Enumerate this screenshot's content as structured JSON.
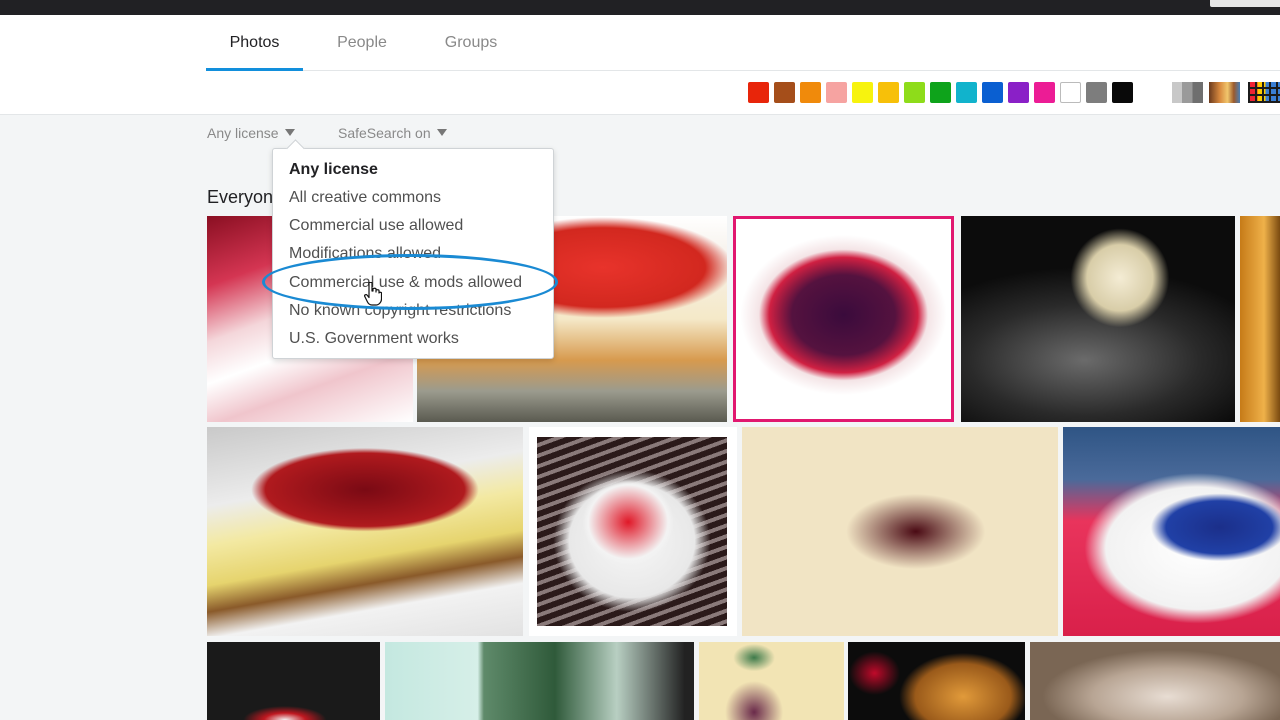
{
  "tabs": [
    {
      "label": "Photos",
      "active": true
    },
    {
      "label": "People",
      "active": false
    },
    {
      "label": "Groups",
      "active": false
    }
  ],
  "color_filters": [
    {
      "name": "red",
      "color": "#e8250a"
    },
    {
      "name": "brown",
      "color": "#a54e1a"
    },
    {
      "name": "orange",
      "color": "#f08a0b"
    },
    {
      "name": "pink",
      "color": "#f6a3a1"
    },
    {
      "name": "yellow",
      "color": "#f7f30e"
    },
    {
      "name": "amber",
      "color": "#f7c009"
    },
    {
      "name": "lime",
      "color": "#8edc1a"
    },
    {
      "name": "green",
      "color": "#0ea31b"
    },
    {
      "name": "teal",
      "color": "#11b3cc"
    },
    {
      "name": "blue",
      "color": "#0a5fd1"
    },
    {
      "name": "purple",
      "color": "#8a20c7"
    },
    {
      "name": "magenta",
      "color": "#ec1c95"
    },
    {
      "name": "white",
      "color": "#ffffff"
    },
    {
      "name": "gray",
      "color": "#7d7d7d"
    },
    {
      "name": "black",
      "color": "#090909"
    }
  ],
  "style_filters": [
    "black-and-white",
    "shallow-depth-of-field",
    "pattern"
  ],
  "filters": {
    "license_label": "Any license",
    "safesearch_label": "SafeSearch on"
  },
  "section_title": "Everyone's photos",
  "license_menu": {
    "options": [
      "Any license",
      "All creative commons",
      "Commercial use allowed",
      "Modifications allowed",
      "Commercial use & mods allowed",
      "No known copyright restrictions",
      "U.S. Government works"
    ],
    "selected": "Any license",
    "hovered": "Commercial use & mods allowed"
  },
  "accent_color": "#128fdc",
  "photos": {
    "row1": [
      "raspberry sauce cheesecake slice",
      "strawberry cheesecake",
      "cherry cheesecake",
      "chocolate drizzle cheesecake",
      "cheesecake partial"
    ],
    "row2": [
      "cherry cheesecake slice",
      "strawberry panna cotta",
      "cherry mini cheesecake with tea",
      "blueberry cheesecake slice"
    ],
    "row3": [
      "dark photo",
      "mint wall",
      "vintage portrait",
      "raspberry crumble",
      "blurred photo"
    ]
  }
}
